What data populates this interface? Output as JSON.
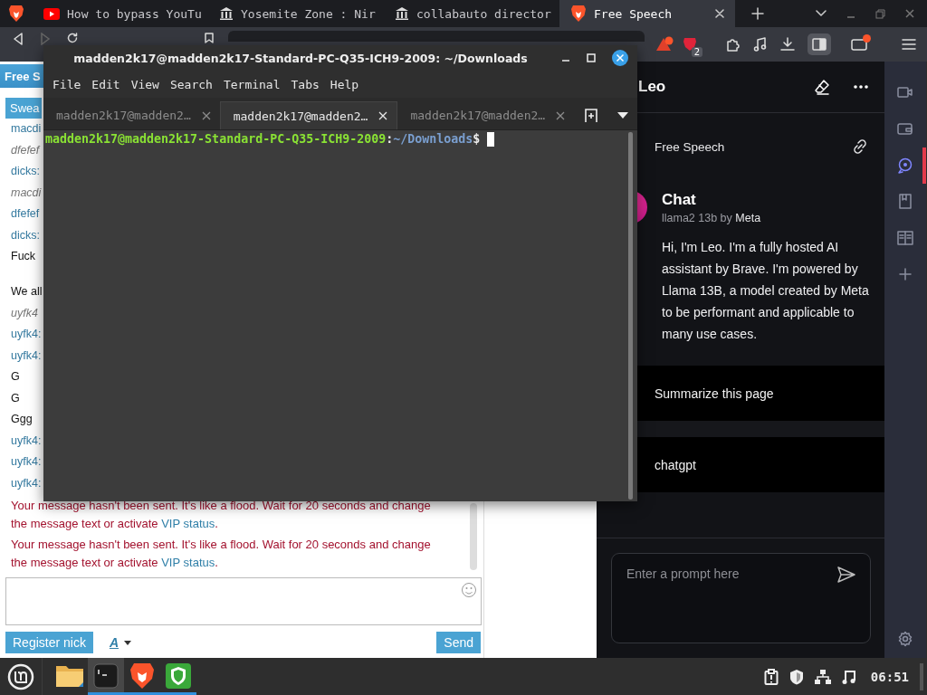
{
  "browser": {
    "tabs": [
      {
        "kind": "pinned",
        "selected": false
      },
      {
        "kind": "video",
        "title": "How to bypass YouTu",
        "selected": false
      },
      {
        "kind": "bank",
        "title": "Yosemite Zone : Nir",
        "selected": false
      },
      {
        "kind": "bank",
        "title": "collabauto director",
        "selected": false
      },
      {
        "kind": "lion",
        "title": "Free Speech",
        "selected": true
      }
    ],
    "leo_badge": "2",
    "sidebar_open": true
  },
  "page": {
    "header": "Free S",
    "swear_button": "Swea",
    "messages": [
      {
        "kind": "nick",
        "text": "macdi"
      },
      {
        "kind": "system",
        "text": "dfefef"
      },
      {
        "kind": "nick",
        "text": "dicks:"
      },
      {
        "kind": "system",
        "text": "macdi"
      },
      {
        "kind": "nick",
        "text": "dfefef"
      },
      {
        "kind": "nick",
        "text": "dicks:"
      },
      {
        "kind": "text",
        "text": "Fuck"
      },
      {
        "kind": "blank"
      },
      {
        "kind": "text",
        "text": "We all"
      },
      {
        "kind": "system",
        "text": "uyfk4"
      },
      {
        "kind": "nick",
        "text": "uyfk4:"
      },
      {
        "kind": "nick",
        "text": "uyfk4:"
      },
      {
        "kind": "text",
        "text": "G"
      },
      {
        "kind": "text",
        "text": "G"
      },
      {
        "kind": "text",
        "text": "Ggg"
      },
      {
        "kind": "nick",
        "text": "uyfk4:"
      },
      {
        "kind": "nick",
        "text": "uyfk4:"
      },
      {
        "kind": "nick",
        "text": "uyfk4:"
      }
    ],
    "errors": [
      {
        "text": "Your message hasn't been sent. It's like a flood. Wait for 20 seconds and change the message text or activate",
        "link": "VIP status",
        "after": "."
      },
      {
        "text": "Your message hasn't been sent. It's like a flood. Wait for 20 seconds and change the message text or activate",
        "link": "VIP status",
        "after": "."
      }
    ],
    "register_button": "Register nick",
    "font_button": "A",
    "send_button": "Send"
  },
  "leo": {
    "title": "Leo",
    "page_title": "Free Speech",
    "chat_title": "Chat",
    "model": "llama2 13b by",
    "maker": "Meta",
    "greeting": "Hi, I'm Leo. I'm a fully hosted AI assistant by Brave. I'm powered by Llama 13B, a model created by Meta to be performant and applicable to many use cases.",
    "suggestions": [
      "Summarize this page",
      "chatgpt"
    ],
    "prompt_placeholder": "Enter a prompt here"
  },
  "rail": [
    {
      "kind": "video",
      "selected": false
    },
    {
      "kind": "wallet",
      "selected": false
    },
    {
      "kind": "leo",
      "selected": true
    },
    {
      "kind": "bookmarks",
      "selected": false
    },
    {
      "kind": "reading",
      "selected": false
    },
    {
      "kind": "add",
      "selected": false
    }
  ],
  "terminal": {
    "title": "madden2k17@madden2k17-Standard-PC-Q35-ICH9-2009: ~/Downloads",
    "menu": [
      "File",
      "Edit",
      "View",
      "Search",
      "Terminal",
      "Tabs",
      "Help"
    ],
    "tabs": [
      {
        "title": "madden2k17@madden2…",
        "selected": false
      },
      {
        "title": "madden2k17@madden2…",
        "selected": true
      },
      {
        "title": "madden2k17@madden2…",
        "selected": false
      }
    ],
    "prompt": {
      "user_host": "madden2k17@madden2k17-Standard-PC-Q35-ICH9-2009",
      "separator": ":",
      "path": "~/Downloads",
      "symbol": "$"
    }
  },
  "taskbar": {
    "apps": [
      {
        "kind": "folder",
        "running": false,
        "selected": false
      },
      {
        "kind": "terminal",
        "running": true,
        "selected": true
      },
      {
        "kind": "lion",
        "running": true,
        "selected": false
      },
      {
        "kind": "shield",
        "running": true,
        "selected": false
      }
    ],
    "clock": "06:51"
  }
}
